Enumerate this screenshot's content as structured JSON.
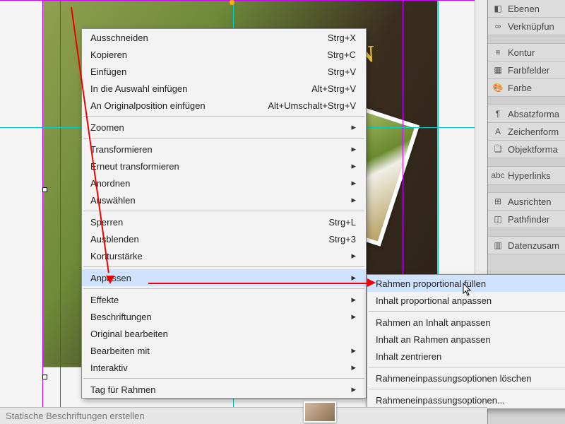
{
  "canvas": {
    "headline": "BEN",
    "bottom_text": "Statische Beschriftungen erstellen"
  },
  "context_menu": {
    "items": [
      {
        "label": "Ausschneiden",
        "shortcut": "Strg+X",
        "type": "item"
      },
      {
        "label": "Kopieren",
        "shortcut": "Strg+C",
        "type": "item"
      },
      {
        "label": "Einfügen",
        "shortcut": "Strg+V",
        "type": "item"
      },
      {
        "label": "In die Auswahl einfügen",
        "shortcut": "Alt+Strg+V",
        "type": "item"
      },
      {
        "label": "An Originalposition einfügen",
        "shortcut": "Alt+Umschalt+Strg+V",
        "type": "item"
      },
      {
        "type": "sep"
      },
      {
        "label": "Zoomen",
        "type": "sub"
      },
      {
        "type": "sep"
      },
      {
        "label": "Transformieren",
        "type": "sub"
      },
      {
        "label": "Erneut transformieren",
        "type": "sub"
      },
      {
        "label": "Anordnen",
        "type": "sub"
      },
      {
        "label": "Auswählen",
        "type": "sub"
      },
      {
        "type": "sep"
      },
      {
        "label": "Sperren",
        "shortcut": "Strg+L",
        "type": "item"
      },
      {
        "label": "Ausblenden",
        "shortcut": "Strg+3",
        "type": "item"
      },
      {
        "label": "Konturstärke",
        "type": "sub"
      },
      {
        "type": "sep"
      },
      {
        "label": "Anpassen",
        "type": "sub",
        "highlight": true
      },
      {
        "type": "sep"
      },
      {
        "label": "Effekte",
        "type": "sub"
      },
      {
        "label": "Beschriftungen",
        "type": "sub"
      },
      {
        "label": "Original bearbeiten",
        "type": "item"
      },
      {
        "label": "Bearbeiten mit",
        "type": "sub"
      },
      {
        "label": "Interaktiv",
        "type": "sub"
      },
      {
        "type": "sep"
      },
      {
        "label": "Tag für Rahmen",
        "type": "sub"
      }
    ]
  },
  "submenu": {
    "items": [
      {
        "label": "Rahmen proportional füllen",
        "highlight": true
      },
      {
        "label": "Inhalt proportional anpassen"
      },
      {
        "type": "sep"
      },
      {
        "label": "Rahmen an Inhalt anpassen"
      },
      {
        "label": "Inhalt an Rahmen anpassen"
      },
      {
        "label": "Inhalt zentrieren"
      },
      {
        "type": "sep"
      },
      {
        "label": "Rahmeneinpassungsoptionen löschen"
      },
      {
        "type": "sep"
      },
      {
        "label": "Rahmeneinpassungsoptionen..."
      }
    ]
  },
  "side_panels": [
    {
      "icon": "◧",
      "label": "Ebenen",
      "name": "layers"
    },
    {
      "icon": "∞",
      "label": "Verknüpfun",
      "name": "links"
    },
    {
      "gap": true
    },
    {
      "icon": "≡",
      "label": "Kontur",
      "name": "stroke"
    },
    {
      "icon": "▦",
      "label": "Farbfelder",
      "name": "swatches"
    },
    {
      "icon": "🎨",
      "label": "Farbe",
      "name": "color"
    },
    {
      "gap": true
    },
    {
      "icon": "¶",
      "label": "Absatzforma",
      "name": "paragraph-styles"
    },
    {
      "icon": "A",
      "label": "Zeichenform",
      "name": "character-styles"
    },
    {
      "icon": "❏",
      "label": "Objektforma",
      "name": "object-styles"
    },
    {
      "gap": true
    },
    {
      "icon": "abc",
      "label": "Hyperlinks",
      "name": "hyperlinks"
    },
    {
      "gap": true
    },
    {
      "icon": "⊞",
      "label": "Ausrichten",
      "name": "align"
    },
    {
      "icon": "◫",
      "label": "Pathfinder",
      "name": "pathfinder"
    },
    {
      "gap": true
    },
    {
      "icon": "▥",
      "label": "Datenzusam",
      "name": "data-merge"
    }
  ]
}
